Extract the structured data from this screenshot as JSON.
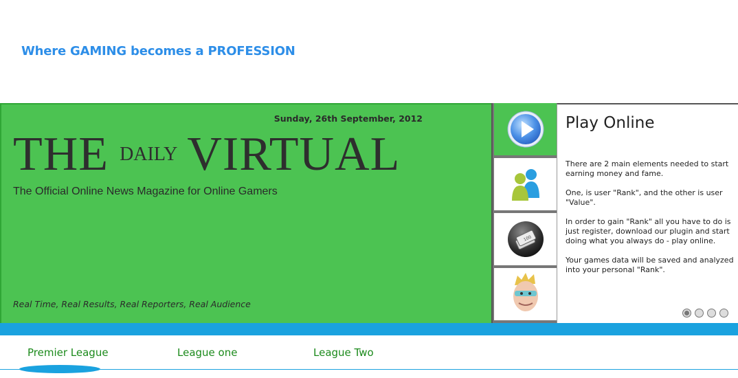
{
  "header": {
    "tagline": "Where GAMING becomes a PROFESSION"
  },
  "hero": {
    "date": "Sunday, 26th September, 2012",
    "masthead_word1": "THE",
    "masthead_word2": "DAILY",
    "masthead_word3": "VIRTUAL",
    "subtitle": "The Official Online News Magazine for Online Gamers",
    "slogan": "Real Time, Real Results, Real Reporters, Real Audience",
    "background_color": "#4cc352"
  },
  "side_menu": {
    "items": [
      {
        "icon": "play-icon",
        "active": true
      },
      {
        "icon": "users-icon",
        "active": false
      },
      {
        "icon": "money-icon",
        "active": false
      },
      {
        "icon": "gamer-face-icon",
        "active": false
      }
    ]
  },
  "panel": {
    "title": "Play Online",
    "paragraphs": [
      "There are 2 main elements needed to start earning money and fame.",
      "One, is user \"Rank\", and the other is user \"Value\".",
      "In order to gain \"Rank\" all you have to do is just register, download our plugin and start doing what you always do - play online.",
      "Your games data will be saved and analyzed into your personal \"Rank\"."
    ],
    "pager": {
      "count": 4,
      "active_index": 0
    }
  },
  "tabs": {
    "items": [
      {
        "label": "Premier League",
        "active": true
      },
      {
        "label": "League one",
        "active": false
      },
      {
        "label": "League Two",
        "active": false
      }
    ],
    "accent_color": "#1aa2df",
    "text_color": "#1b8a1b"
  }
}
